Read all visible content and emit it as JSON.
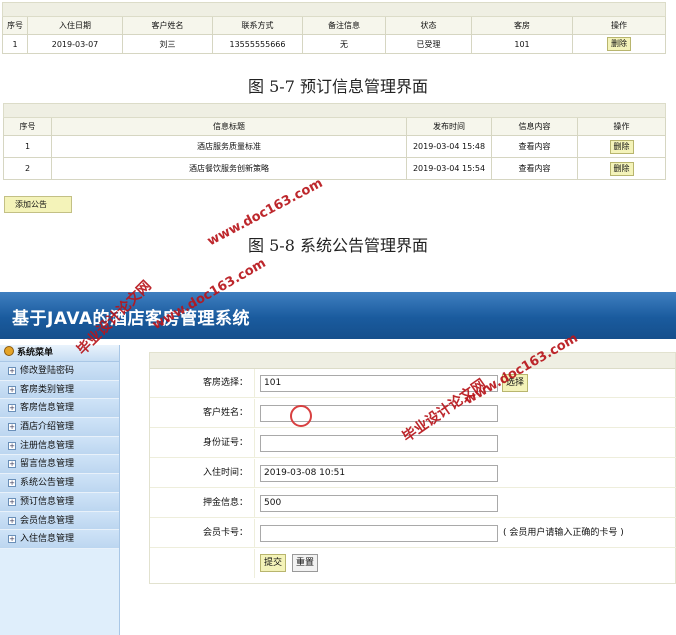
{
  "booking_table": {
    "columns": [
      "序号",
      "入住日期",
      "客户姓名",
      "联系方式",
      "备注信息",
      "状态",
      "客房",
      "操作"
    ],
    "rows": [
      {
        "no": "1",
        "date": "2019-03-07",
        "name": "刘三",
        "phone": "13555555666",
        "note": "无",
        "status": "已受理",
        "room": "101",
        "action": "删除"
      }
    ]
  },
  "caption_1": "图 5-7 预订信息管理界面",
  "notice_table": {
    "columns": [
      "序号",
      "信息标题",
      "发布时间",
      "信息内容",
      "操作"
    ],
    "rows": [
      {
        "no": "1",
        "title": "酒店服务质量标准",
        "time": "2019-03-04 15:48",
        "content": "查看内容",
        "action": "删除"
      },
      {
        "no": "2",
        "title": "酒店餐饮服务创新策略",
        "time": "2019-03-04 15:54",
        "content": "查看内容",
        "action": "删除"
      }
    ],
    "add_label": "添加公告"
  },
  "caption_2": "图 5-8 系统公告管理界面",
  "admin": {
    "title": "基于JAVA的酒店客房管理系统",
    "sidebar": {
      "header": "系统菜单",
      "items": [
        "修改登陆密码",
        "客房类别管理",
        "客房信息管理",
        "酒店介绍管理",
        "注册信息管理",
        "留言信息管理",
        "系统公告管理",
        "预订信息管理",
        "会员信息管理",
        "入住信息管理"
      ]
    },
    "form": {
      "room_label": "客房选择：",
      "room_value": "101",
      "select_label": "选择",
      "name_label": "客户姓名：",
      "name_value": "",
      "id_label": "身份证号：",
      "id_value": "",
      "checkin_label": "入住时间：",
      "checkin_value": "2019-03-08 10:51",
      "deposit_label": "押金信息：",
      "deposit_value": "500",
      "member_label": "会员卡号：",
      "member_value": "",
      "member_hint": "( 会员用户请输入正确的卡号 )",
      "submit_label": "提交",
      "reset_label": "重置"
    }
  },
  "watermarks": {
    "wm1": "www.doc163.com",
    "wm2": "毕业设计论文网",
    "wm3": "www.doc163.com",
    "wm4": "毕业设计论文网",
    "wm5": "www.doc163.com"
  },
  "colors": {
    "banner": "#1a5b9e",
    "button_yellow": "#f4f3b9",
    "watermark_red": "#b8151b"
  }
}
